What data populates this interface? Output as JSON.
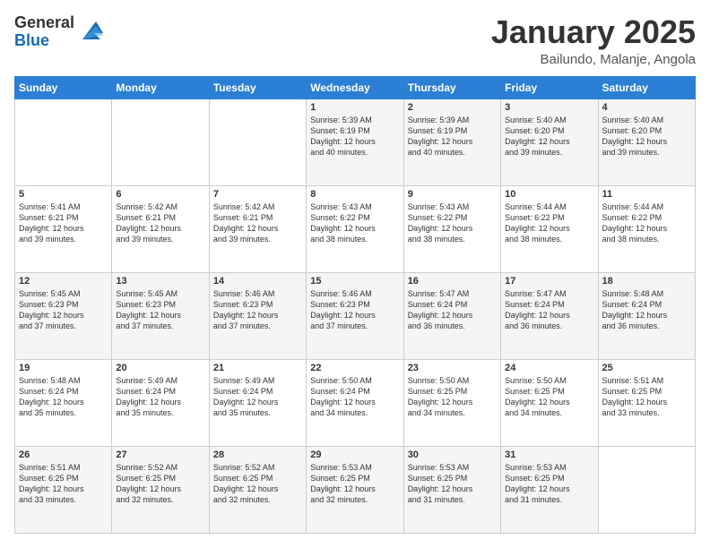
{
  "header": {
    "logo": {
      "line1": "General",
      "line2": "Blue"
    },
    "title": "January 2025",
    "subtitle": "Bailundo, Malanje, Angola"
  },
  "weekdays": [
    "Sunday",
    "Monday",
    "Tuesday",
    "Wednesday",
    "Thursday",
    "Friday",
    "Saturday"
  ],
  "weeks": [
    [
      {
        "day": "",
        "info": ""
      },
      {
        "day": "",
        "info": ""
      },
      {
        "day": "",
        "info": ""
      },
      {
        "day": "1",
        "info": "Sunrise: 5:39 AM\nSunset: 6:19 PM\nDaylight: 12 hours\nand 40 minutes."
      },
      {
        "day": "2",
        "info": "Sunrise: 5:39 AM\nSunset: 6:19 PM\nDaylight: 12 hours\nand 40 minutes."
      },
      {
        "day": "3",
        "info": "Sunrise: 5:40 AM\nSunset: 6:20 PM\nDaylight: 12 hours\nand 39 minutes."
      },
      {
        "day": "4",
        "info": "Sunrise: 5:40 AM\nSunset: 6:20 PM\nDaylight: 12 hours\nand 39 minutes."
      }
    ],
    [
      {
        "day": "5",
        "info": "Sunrise: 5:41 AM\nSunset: 6:21 PM\nDaylight: 12 hours\nand 39 minutes."
      },
      {
        "day": "6",
        "info": "Sunrise: 5:42 AM\nSunset: 6:21 PM\nDaylight: 12 hours\nand 39 minutes."
      },
      {
        "day": "7",
        "info": "Sunrise: 5:42 AM\nSunset: 6:21 PM\nDaylight: 12 hours\nand 39 minutes."
      },
      {
        "day": "8",
        "info": "Sunrise: 5:43 AM\nSunset: 6:22 PM\nDaylight: 12 hours\nand 38 minutes."
      },
      {
        "day": "9",
        "info": "Sunrise: 5:43 AM\nSunset: 6:22 PM\nDaylight: 12 hours\nand 38 minutes."
      },
      {
        "day": "10",
        "info": "Sunrise: 5:44 AM\nSunset: 6:22 PM\nDaylight: 12 hours\nand 38 minutes."
      },
      {
        "day": "11",
        "info": "Sunrise: 5:44 AM\nSunset: 6:22 PM\nDaylight: 12 hours\nand 38 minutes."
      }
    ],
    [
      {
        "day": "12",
        "info": "Sunrise: 5:45 AM\nSunset: 6:23 PM\nDaylight: 12 hours\nand 37 minutes."
      },
      {
        "day": "13",
        "info": "Sunrise: 5:45 AM\nSunset: 6:23 PM\nDaylight: 12 hours\nand 37 minutes."
      },
      {
        "day": "14",
        "info": "Sunrise: 5:46 AM\nSunset: 6:23 PM\nDaylight: 12 hours\nand 37 minutes."
      },
      {
        "day": "15",
        "info": "Sunrise: 5:46 AM\nSunset: 6:23 PM\nDaylight: 12 hours\nand 37 minutes."
      },
      {
        "day": "16",
        "info": "Sunrise: 5:47 AM\nSunset: 6:24 PM\nDaylight: 12 hours\nand 36 minutes."
      },
      {
        "day": "17",
        "info": "Sunrise: 5:47 AM\nSunset: 6:24 PM\nDaylight: 12 hours\nand 36 minutes."
      },
      {
        "day": "18",
        "info": "Sunrise: 5:48 AM\nSunset: 6:24 PM\nDaylight: 12 hours\nand 36 minutes."
      }
    ],
    [
      {
        "day": "19",
        "info": "Sunrise: 5:48 AM\nSunset: 6:24 PM\nDaylight: 12 hours\nand 35 minutes."
      },
      {
        "day": "20",
        "info": "Sunrise: 5:49 AM\nSunset: 6:24 PM\nDaylight: 12 hours\nand 35 minutes."
      },
      {
        "day": "21",
        "info": "Sunrise: 5:49 AM\nSunset: 6:24 PM\nDaylight: 12 hours\nand 35 minutes."
      },
      {
        "day": "22",
        "info": "Sunrise: 5:50 AM\nSunset: 6:24 PM\nDaylight: 12 hours\nand 34 minutes."
      },
      {
        "day": "23",
        "info": "Sunrise: 5:50 AM\nSunset: 6:25 PM\nDaylight: 12 hours\nand 34 minutes."
      },
      {
        "day": "24",
        "info": "Sunrise: 5:50 AM\nSunset: 6:25 PM\nDaylight: 12 hours\nand 34 minutes."
      },
      {
        "day": "25",
        "info": "Sunrise: 5:51 AM\nSunset: 6:25 PM\nDaylight: 12 hours\nand 33 minutes."
      }
    ],
    [
      {
        "day": "26",
        "info": "Sunrise: 5:51 AM\nSunset: 6:25 PM\nDaylight: 12 hours\nand 33 minutes."
      },
      {
        "day": "27",
        "info": "Sunrise: 5:52 AM\nSunset: 6:25 PM\nDaylight: 12 hours\nand 32 minutes."
      },
      {
        "day": "28",
        "info": "Sunrise: 5:52 AM\nSunset: 6:25 PM\nDaylight: 12 hours\nand 32 minutes."
      },
      {
        "day": "29",
        "info": "Sunrise: 5:53 AM\nSunset: 6:25 PM\nDaylight: 12 hours\nand 32 minutes."
      },
      {
        "day": "30",
        "info": "Sunrise: 5:53 AM\nSunset: 6:25 PM\nDaylight: 12 hours\nand 31 minutes."
      },
      {
        "day": "31",
        "info": "Sunrise: 5:53 AM\nSunset: 6:25 PM\nDaylight: 12 hours\nand 31 minutes."
      },
      {
        "day": "",
        "info": ""
      }
    ]
  ]
}
